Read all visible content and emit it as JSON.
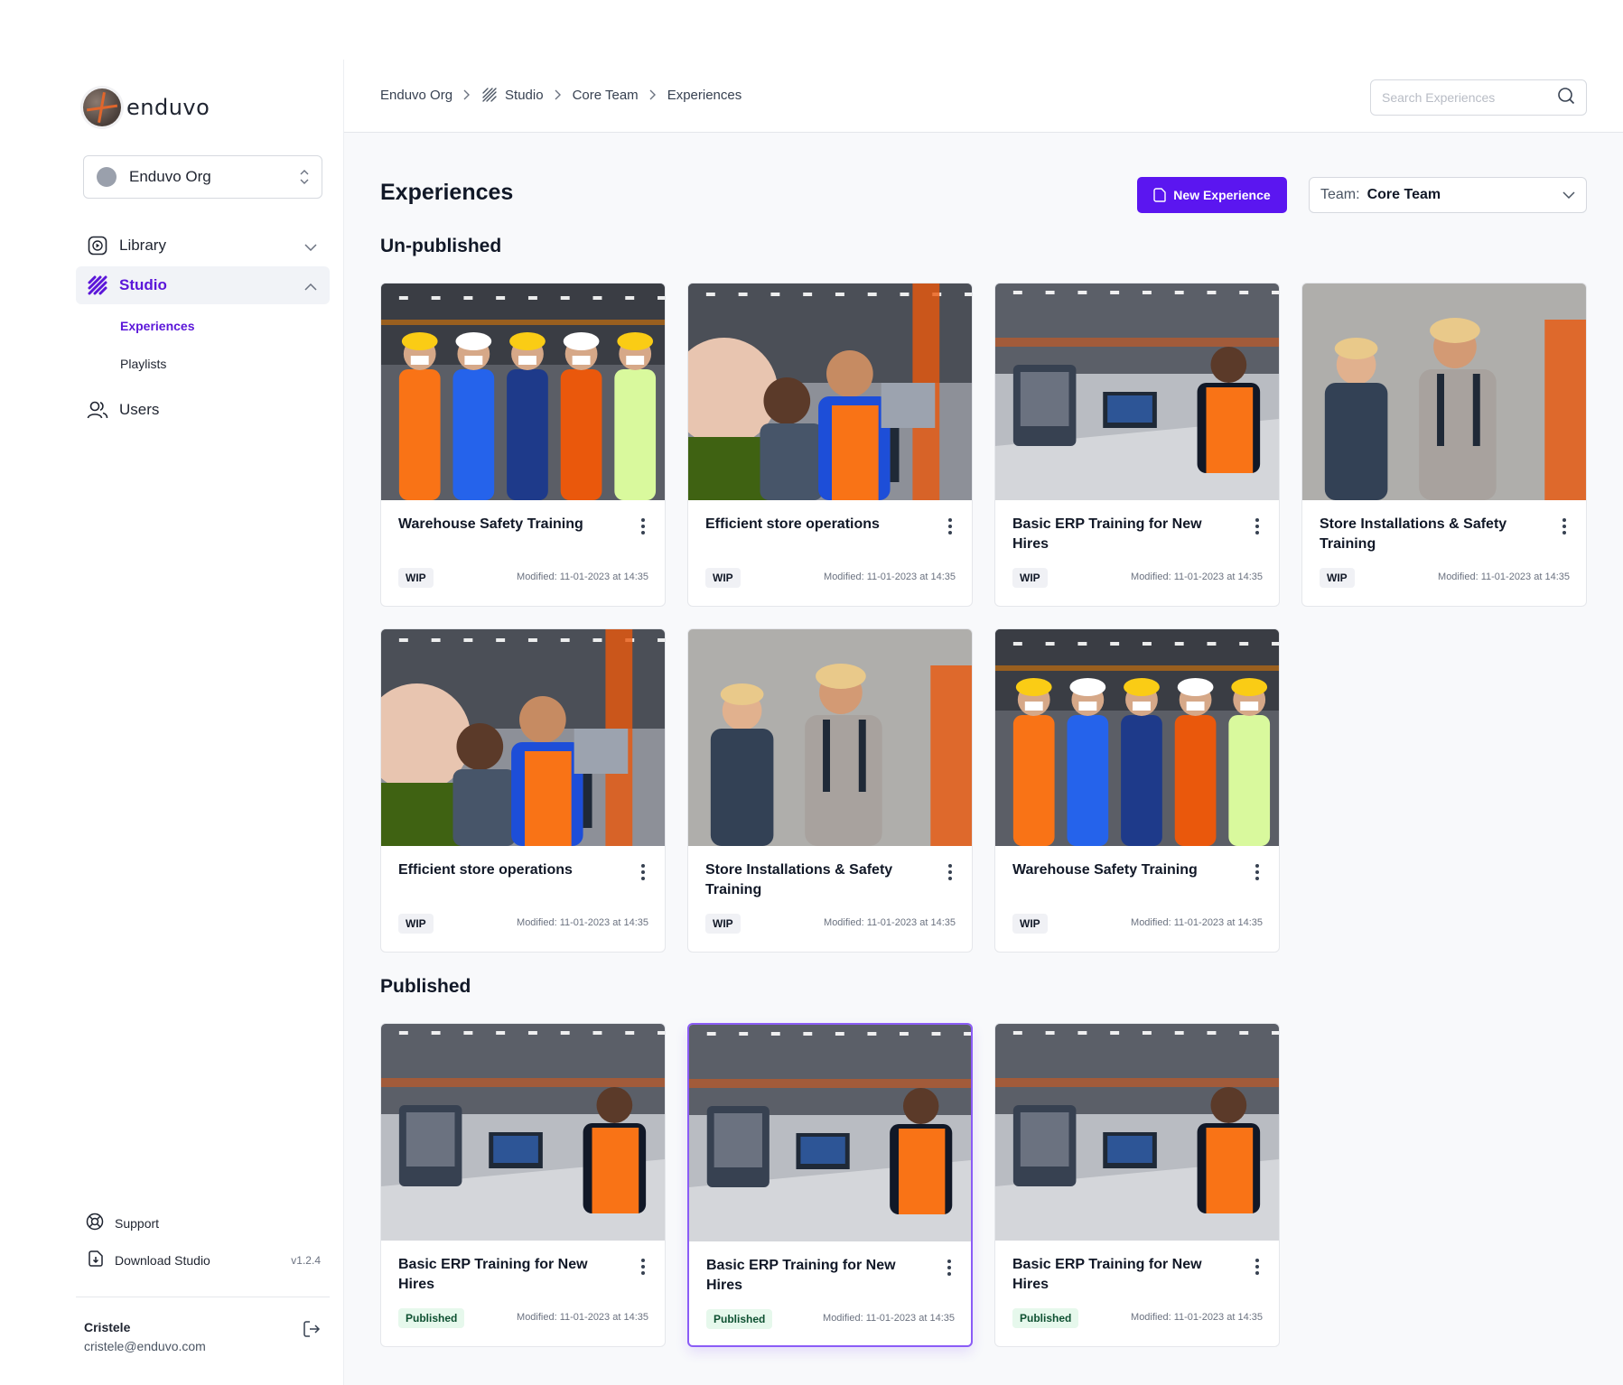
{
  "app": {
    "logo_text": "enduvo"
  },
  "org": {
    "name": "Enduvo Org"
  },
  "sidebar": {
    "nav": [
      {
        "label": "Library"
      },
      {
        "label": "Studio"
      },
      {
        "label": "Users"
      }
    ],
    "studio_sub": [
      {
        "label": "Experiences"
      },
      {
        "label": "Playlists"
      }
    ],
    "support_label": "Support",
    "download_label": "Download Studio",
    "version": "v1.2.4",
    "user": {
      "name": "Cristele",
      "email": "cristele@enduvo.com"
    }
  },
  "breadcrumb": [
    "Enduvo Org",
    "Studio",
    "Core Team",
    "Experiences"
  ],
  "search": {
    "placeholder": "Search Experiences",
    "value": ""
  },
  "page": {
    "title": "Experiences",
    "new_button": "New Experience",
    "team_label": "Team:",
    "team_value": "Core Team"
  },
  "sections": {
    "unpublished_title": "Un-published",
    "published_title": "Published"
  },
  "unpublished": [
    {
      "title": "Warehouse Safety Training",
      "status": "WIP",
      "modified": "Modified: 11-01-2023 at 14:35",
      "image": "warehouse-team"
    },
    {
      "title": "Efficient store operations",
      "status": "WIP",
      "modified": "Modified: 11-01-2023 at 14:35",
      "image": "store-operations"
    },
    {
      "title": "Basic ERP Training for New Hires",
      "status": "WIP",
      "modified": "Modified: 11-01-2023 at 14:35",
      "image": "erp-computer"
    },
    {
      "title": "Store Installations & Safety Training",
      "status": "WIP",
      "modified": "Modified: 11-01-2023 at 14:35",
      "image": "installations"
    },
    {
      "title": "Efficient store operations",
      "status": "WIP",
      "modified": "Modified: 11-01-2023 at 14:35",
      "image": "store-operations"
    },
    {
      "title": "Store Installations & Safety Training",
      "status": "WIP",
      "modified": "Modified: 11-01-2023 at 14:35",
      "image": "installations"
    },
    {
      "title": "Warehouse Safety Training",
      "status": "WIP",
      "modified": "Modified: 11-01-2023 at 14:35",
      "image": "warehouse-team"
    }
  ],
  "published": [
    {
      "title": "Basic ERP Training for New Hires",
      "status": "Published",
      "modified": "Modified: 11-01-2023 at 14:35",
      "image": "erp-computer"
    },
    {
      "title": "Basic ERP Training for New Hires",
      "status": "Published",
      "modified": "Modified: 11-01-2023 at 14:35",
      "image": "erp-computer",
      "selected": true
    },
    {
      "title": "Basic ERP Training for New Hires",
      "status": "Published",
      "modified": "Modified: 11-01-2023 at 14:35",
      "image": "erp-computer"
    }
  ],
  "colors": {
    "accent": "#5b16f0",
    "accent_text": "#5b16d9",
    "published_bg": "#e6f8ec",
    "wip_bg": "#f0f1f5"
  }
}
